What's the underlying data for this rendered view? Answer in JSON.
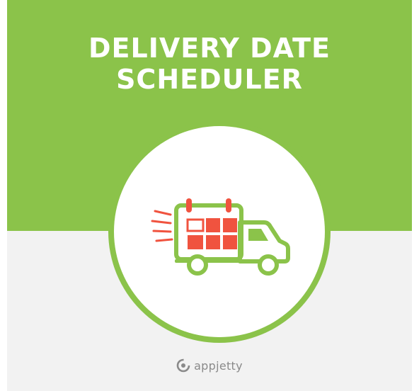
{
  "banner": {
    "title_line1": "DELIVERY DATE",
    "title_line2": "SCHEDULER"
  },
  "logo": {
    "icon": "delivery-truck-calendar-icon"
  },
  "brand": {
    "icon": "appjetty-logo-icon",
    "name": "appjetty"
  },
  "colors": {
    "brand_green": "#8bc34a",
    "background_grey": "#f2f2f2",
    "calendar_red": "#f0533f",
    "brand_grey": "#8a8a8a",
    "white": "#ffffff"
  }
}
